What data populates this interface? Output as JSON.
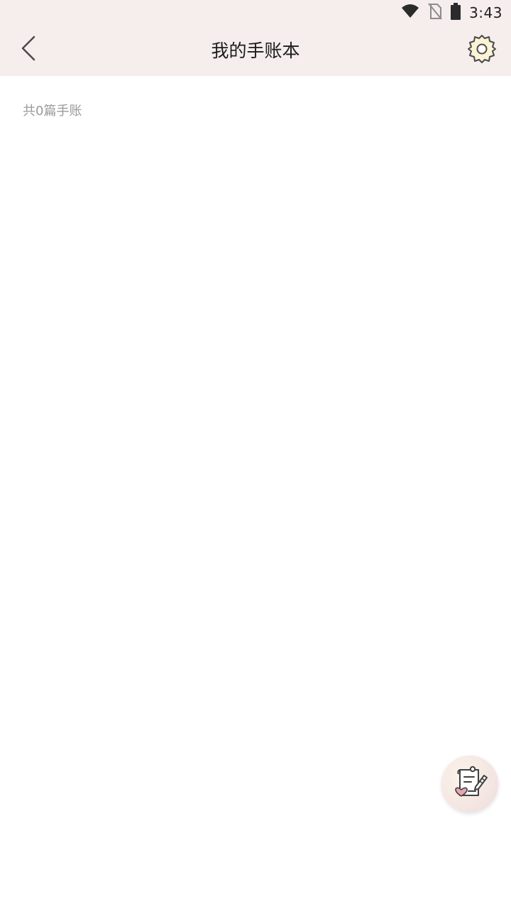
{
  "status_bar": {
    "time": "3:43",
    "icons": [
      "wifi-icon",
      "no-sim-icon",
      "battery-icon"
    ]
  },
  "header": {
    "title": "我的手账本",
    "back_icon": "chevron-left-icon",
    "settings_icon": "gear-icon"
  },
  "main": {
    "count_text": "共0篇手账"
  },
  "fab": {
    "icon": "write-journal-icon"
  },
  "colors": {
    "header_bg": "#f6eded",
    "page_bg": "#ffffff",
    "gear_fill": "#fbf3d6",
    "secondary_text": "#9a9a9a",
    "accent_pink": "#e8a6b0"
  }
}
